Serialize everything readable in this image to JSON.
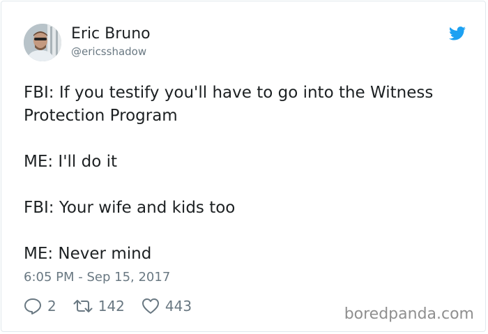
{
  "author": {
    "display_name": "Eric Bruno",
    "handle": "@ericsshadow",
    "avatar_icon": "profile-photo"
  },
  "tweet": {
    "paragraphs": [
      "FBI: If you testify you'll have to go into the Witness Protection Program",
      "ME: I'll do it",
      "FBI: Your wife and kids too",
      "ME: Never mind"
    ],
    "timestamp": "6:05 PM - Sep 15, 2017"
  },
  "actions": {
    "replies": "2",
    "retweets": "142",
    "likes": "443"
  },
  "brand": {
    "icon": "twitter-bird-icon",
    "color": "#1da1f2"
  },
  "watermark": "boredpanda.com"
}
